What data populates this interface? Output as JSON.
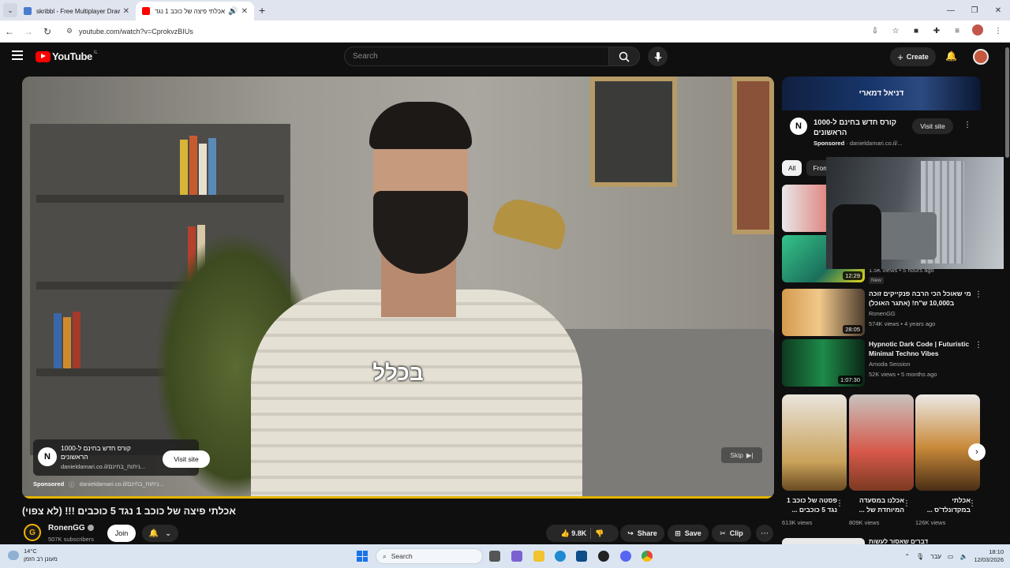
{
  "browser": {
    "tabs": [
      {
        "title": "skribbl - Free Multiplayer Drawi",
        "active": false,
        "favicon_color": "#4a7bd0"
      },
      {
        "title": "אכלתי פיצה של כוכב 1 נגד",
        "active": true,
        "favicon_color": "#ff0000"
      }
    ],
    "url": "youtube.com/watch?v=CprokvzBIUs"
  },
  "youtube": {
    "logo_text": "YouTube",
    "country_code": "IL",
    "search_placeholder": "Search",
    "create_label": "Create"
  },
  "player": {
    "caption": "בכלל",
    "ad": {
      "title": "קורס חדש בחינם ל-1000 הראשונים",
      "domain": "danieldamari.co.il/ניתוח_בחינם...",
      "visit_label": "Visit site",
      "sponsored_label": "Sponsored",
      "sponsored_domain": "danieldamari.co.il/ניתוח_בחינם..."
    },
    "skip_label": "Skip",
    "progress": 1.0
  },
  "video": {
    "title": "אכלתי פיצה של כוכב 1 נגד 5 כוכבים !!! (לא צפוי)",
    "channel": "RonenGG",
    "subscribers": "507K subscribers",
    "join_label": "Join",
    "likes": "9.8K",
    "share_label": "Share",
    "save_label": "Save",
    "clip_label": "Clip"
  },
  "sidebar": {
    "ad": {
      "banner_text": "דניאל דמארי",
      "title": "קורס חדש בחינם ל-1000 הראשונים",
      "sponsored_label": "Sponsored",
      "domain": "danieldamari.co.il/...",
      "visit_label": "Visit site"
    },
    "chips": [
      "All",
      "From"
    ],
    "recommendations": [
      {
        "title": "",
        "channel": "",
        "meta": "",
        "duration": ""
      },
      {
        "title": "",
        "channel": "",
        "meta": "1.5K views • 5 hours ago",
        "badge": "New",
        "duration": "12:29"
      },
      {
        "title": "מי שאוכל הכי הרבה פנקייקים זוכה ב10,000 ש\"ח! (אתגר האוכל)",
        "channel": "RonenGG",
        "meta": "574K views • 4 years ago",
        "duration": "28:05"
      },
      {
        "title": "Hypnotic Dark Code | Futuristic Minimal Techno Vibes",
        "channel": "Amoda Session",
        "meta": "52K views • 5 months ago",
        "duration": "1:07:30"
      }
    ],
    "shorts": [
      {
        "title": "פסטה של כוכב 1 נגד 5 כוכבים ...",
        "views": "613K views"
      },
      {
        "title": "אכלנו במסעדה המיוחדת של ...",
        "views": "809K views"
      },
      {
        "title": "אכלתי במקדונלד'ס ...",
        "views": "126K views"
      }
    ],
    "bottom_peek_title": "דברים שאסור לעשות"
  },
  "taskbar": {
    "weather_temp": "14°C",
    "weather_desc": "מעונן רב הזמן",
    "search_label": "Search",
    "lang": "עבר",
    "time": "18:10",
    "date": "12/03/2026"
  },
  "colors": {
    "yt_red": "#ff0000",
    "progress": "#e3b500",
    "bg": "#0f0f0f"
  }
}
